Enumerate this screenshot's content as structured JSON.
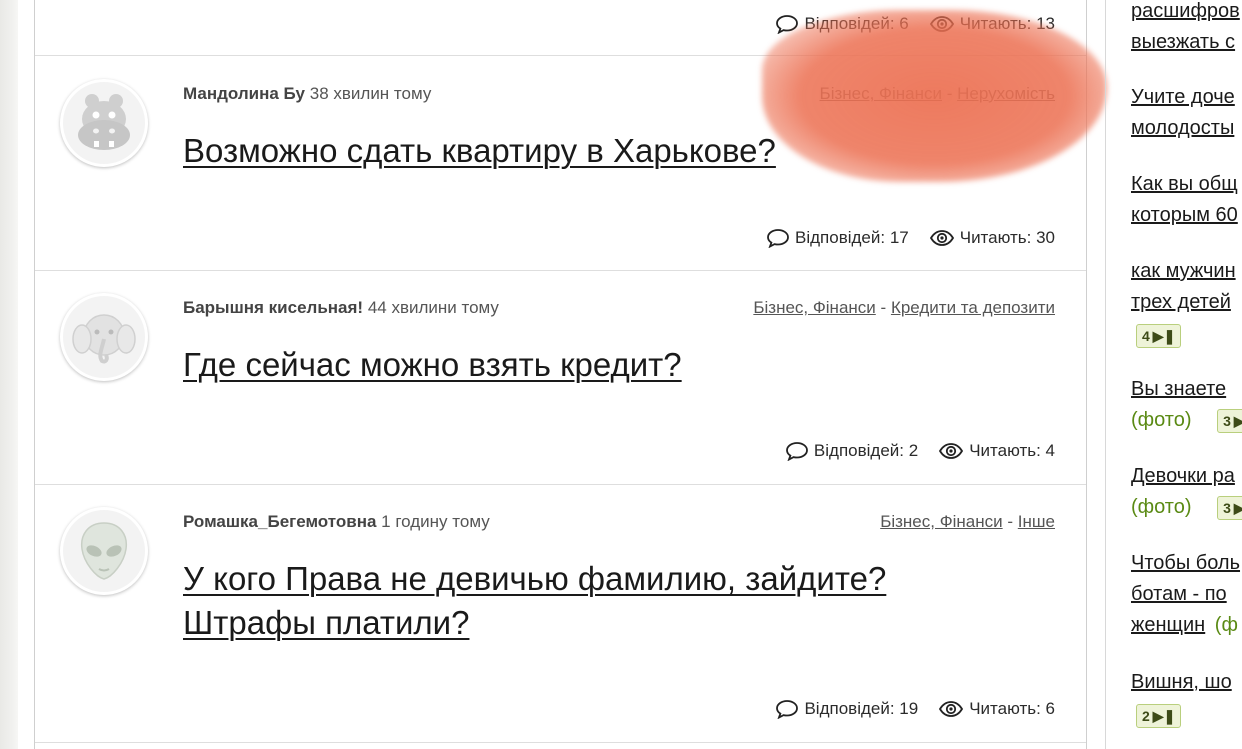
{
  "top_stats": {
    "replies": "Відповідей: 6",
    "reading": "Читають: 13"
  },
  "questions": [
    {
      "author": "Мандолина Бу",
      "time": "38 хвилин тому",
      "categories": [
        "Бізнес, Фінанси",
        "Нерухомість"
      ],
      "separator": "-",
      "title": "Возможно сдать квартиру в Харькове?",
      "replies": "Відповідей: 17",
      "reading": "Читають: 30",
      "avatar_icon": "hippo-icon"
    },
    {
      "author": "Барышня кисельная!",
      "time": "44 хвилини тому",
      "categories": [
        "Бізнес, Фінанси",
        "Кредити та депозити"
      ],
      "separator": "-",
      "title": "Где сейчас можно взять кредит?",
      "replies": "Відповідей: 2",
      "reading": "Читають: 4",
      "avatar_icon": "elephant-icon"
    },
    {
      "author": "Ромашка_Бегемотовна",
      "time": "1 годину тому",
      "categories": [
        "Бізнес, Фінанси",
        "Інше"
      ],
      "separator": "-",
      "title": "У кого Права не девичью фамилию, зайдите? Штрафы платили?",
      "replies": "Відповідей: 19",
      "reading": "Читають: 6",
      "avatar_icon": "alien-icon"
    }
  ],
  "sidebar": {
    "items": [
      {
        "lines": [
          "расшифров",
          "выезжать с"
        ]
      },
      {
        "lines": [
          "Учите доче",
          "молодосты"
        ]
      },
      {
        "lines": [
          "Как вы общ",
          "которым 60"
        ]
      },
      {
        "lines": [
          "как мужчин",
          "трех детей"
        ],
        "badge": "4"
      },
      {
        "lines": [
          "Вы знаете"
        ],
        "photo": "(фото)",
        "badge": "3"
      },
      {
        "lines": [
          "Девочки ра"
        ],
        "photo": "(фото)",
        "badge": "3"
      },
      {
        "lines": [
          "Чтобы боль",
          "ботам - по",
          "женщин"
        ],
        "photo": "(ф"
      },
      {
        "lines": [
          "Вишня, шо"
        ],
        "badge": "2"
      }
    ]
  },
  "colors": {
    "accent_photo": "#5a8a14",
    "badge_bg": "#eef3d8",
    "scribble": "#ec7052"
  }
}
